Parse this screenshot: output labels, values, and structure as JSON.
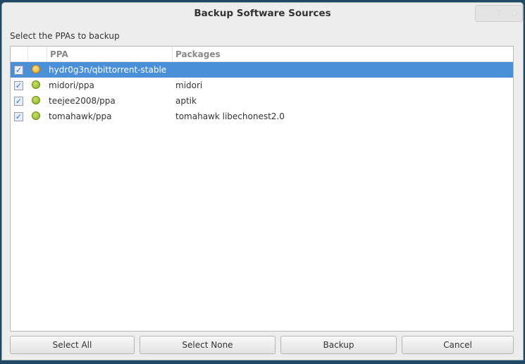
{
  "window": {
    "title": "Backup Software Sources",
    "controls": [
      "_",
      "▫",
      "×"
    ]
  },
  "prompt": "Select the PPAs to backup",
  "columns": {
    "ppa": "PPA",
    "packages": "Packages"
  },
  "rows": [
    {
      "ppa": "hydr0g3n/qbittorrent-stable",
      "packages": "",
      "checked": true,
      "status": "yellow",
      "selected": true
    },
    {
      "ppa": "midori/ppa",
      "packages": "midori",
      "checked": true,
      "status": "green"
    },
    {
      "ppa": "teejee2008/ppa",
      "packages": "aptik",
      "checked": true,
      "status": "green"
    },
    {
      "ppa": "tomahawk/ppa",
      "packages": "tomahawk libechonest2.0",
      "checked": true,
      "status": "green"
    }
  ],
  "buttons": {
    "select_all": "Select All",
    "select_none": "Select None",
    "backup": "Backup",
    "cancel": "Cancel"
  }
}
